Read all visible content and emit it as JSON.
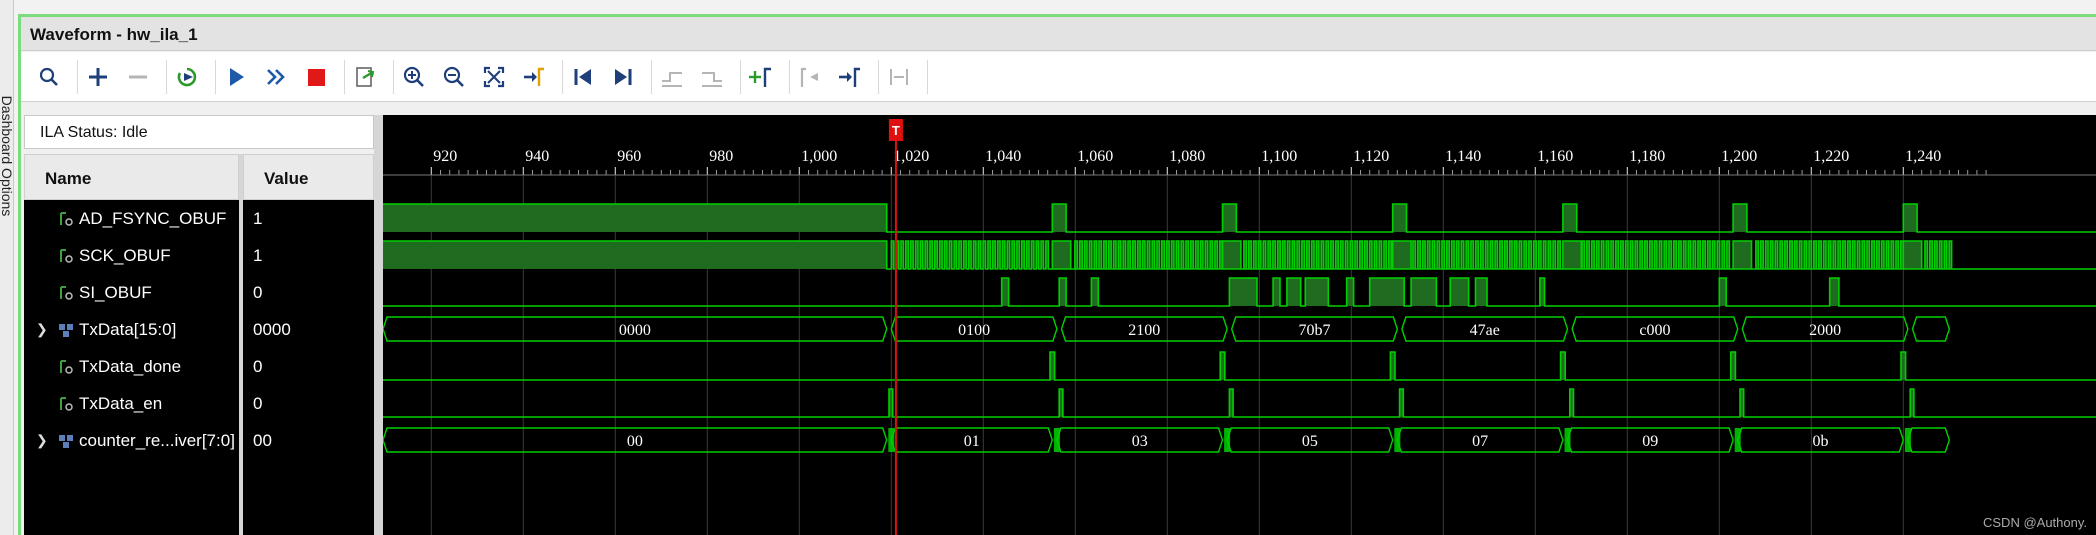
{
  "side_tab": {
    "label": "Dashboard Options"
  },
  "window": {
    "title": "Waveform - hw_ila_1"
  },
  "toolbar": {
    "buttons": [
      {
        "name": "search-icon",
        "enabled": true
      },
      {
        "name": "add-icon",
        "enabled": true
      },
      {
        "name": "remove-icon",
        "enabled": false
      },
      {
        "name": "run-trigger-icon",
        "enabled": true
      },
      {
        "name": "play-icon",
        "enabled": true
      },
      {
        "name": "fast-forward-icon",
        "enabled": true
      },
      {
        "name": "stop-icon",
        "enabled": true
      },
      {
        "name": "export-icon",
        "enabled": true
      },
      {
        "name": "zoom-in-icon",
        "enabled": true
      },
      {
        "name": "zoom-out-icon",
        "enabled": true
      },
      {
        "name": "zoom-fit-icon",
        "enabled": true
      },
      {
        "name": "go-to-cursor-icon",
        "enabled": true
      },
      {
        "name": "go-to-start-icon",
        "enabled": true
      },
      {
        "name": "go-to-end-icon",
        "enabled": true
      },
      {
        "name": "previous-transition-icon",
        "enabled": false
      },
      {
        "name": "next-transition-icon",
        "enabled": false
      },
      {
        "name": "add-marker-icon",
        "enabled": true
      },
      {
        "name": "previous-marker-icon",
        "enabled": false
      },
      {
        "name": "next-marker-icon",
        "enabled": true
      },
      {
        "name": "swap-cursor-icon",
        "enabled": false
      }
    ]
  },
  "ila_status": {
    "text": "ILA Status: Idle"
  },
  "columns": {
    "name": "Name",
    "value": "Value"
  },
  "signals": [
    {
      "name": "AD_FSYNC_OBUF",
      "value": "1",
      "type": "bit",
      "expandable": false
    },
    {
      "name": "SCK_OBUF",
      "value": "1",
      "type": "bit",
      "expandable": false
    },
    {
      "name": "SI_OBUF",
      "value": "0",
      "type": "bit",
      "expandable": false
    },
    {
      "name": "TxData[15:0]",
      "value": "0000",
      "type": "bus",
      "expandable": true
    },
    {
      "name": "TxData_done",
      "value": "0",
      "type": "bit",
      "expandable": false
    },
    {
      "name": "TxData_en",
      "value": "0",
      "type": "bit",
      "expandable": false
    },
    {
      "name": "counter_re...iver[7:0]",
      "value": "00",
      "type": "bus",
      "expandable": true
    }
  ],
  "timeline": {
    "ticks": [
      "920",
      "940",
      "960",
      "980",
      "1,000",
      "1,020",
      "1,040",
      "1,060",
      "1,080",
      "1,100",
      "1,120",
      "1,140",
      "1,160",
      "1,180",
      "1,200",
      "1,220",
      "1,240"
    ],
    "tick_values": [
      920,
      940,
      960,
      980,
      1000,
      1020,
      1040,
      1060,
      1080,
      1100,
      1120,
      1140,
      1160,
      1180,
      1200,
      1220,
      1240
    ],
    "trigger_marker": {
      "label": "T",
      "sample": 1021
    }
  },
  "bus_segments": {
    "TxData": [
      {
        "start": 909,
        "end": 1019,
        "text": "0000"
      },
      {
        "start": 1020,
        "end": 1056,
        "text": "0100"
      },
      {
        "start": 1057,
        "end": 1093,
        "text": "2100"
      },
      {
        "start": 1094,
        "end": 1130,
        "text": "70b7"
      },
      {
        "start": 1131,
        "end": 1167,
        "text": "47ae"
      },
      {
        "start": 1168,
        "end": 1204,
        "text": "c000"
      },
      {
        "start": 1205,
        "end": 1241,
        "text": "2000"
      },
      {
        "start": 1242,
        "end": 1250,
        "text": ""
      }
    ],
    "counter": [
      {
        "start": 909,
        "end": 1019,
        "text": "00"
      },
      {
        "start": 1020,
        "end": 1055,
        "text": "01"
      },
      {
        "start": 1056,
        "end": 1092,
        "text": "03"
      },
      {
        "start": 1093,
        "end": 1129,
        "text": "05"
      },
      {
        "start": 1130,
        "end": 1166,
        "text": "07"
      },
      {
        "start": 1167,
        "end": 1203,
        "text": "09"
      },
      {
        "start": 1204,
        "end": 1240,
        "text": "0b"
      },
      {
        "start": 1241,
        "end": 1250,
        "text": ""
      }
    ]
  },
  "colors": {
    "wave": "#00d000",
    "fill": "#1f6b1f",
    "trigger": "#e01010",
    "grid": "#3a3a3a",
    "window_border": "#7cdc7c"
  },
  "watermark": "CSDN @Authony."
}
